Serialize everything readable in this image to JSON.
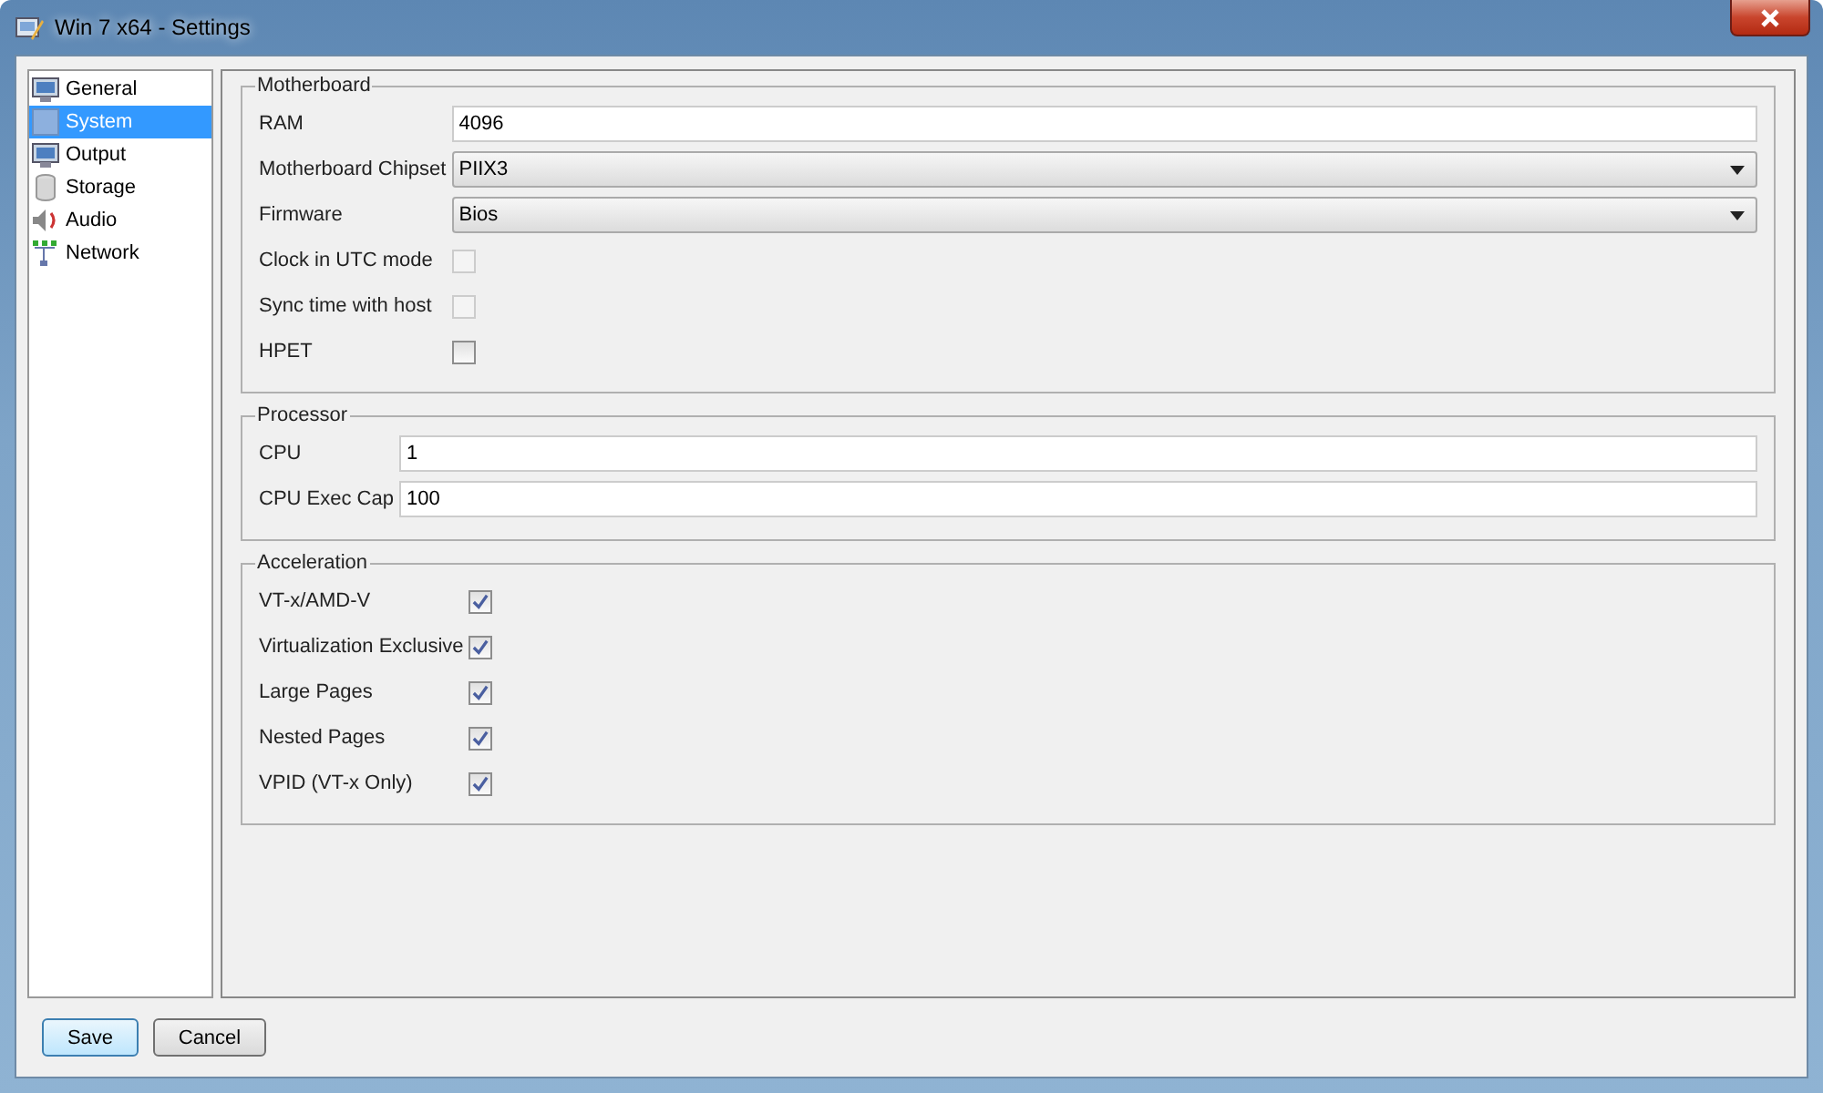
{
  "window": {
    "title": "Win 7 x64 - Settings"
  },
  "sidebar": {
    "items": [
      {
        "label": "General",
        "selected": false
      },
      {
        "label": "System",
        "selected": true
      },
      {
        "label": "Output",
        "selected": false
      },
      {
        "label": "Storage",
        "selected": false
      },
      {
        "label": "Audio",
        "selected": false
      },
      {
        "label": "Network",
        "selected": false
      }
    ]
  },
  "groups": [
    {
      "title": "Motherboard",
      "rows": [
        {
          "kind": "text",
          "label": "RAM",
          "value": "4096"
        },
        {
          "kind": "select",
          "label": "Motherboard Chipset",
          "value": "PIIX3"
        },
        {
          "kind": "select",
          "label": "Firmware",
          "value": "Bios"
        },
        {
          "kind": "checkbox",
          "label": "Clock in UTC mode",
          "checked": false,
          "disabled": true
        },
        {
          "kind": "checkbox",
          "label": "Sync time with host",
          "checked": false,
          "disabled": true
        },
        {
          "kind": "checkbox",
          "label": "HPET",
          "checked": false,
          "disabled": false
        }
      ]
    },
    {
      "title": "Processor",
      "rows": [
        {
          "kind": "text",
          "label": "CPU",
          "value": "1"
        },
        {
          "kind": "text",
          "label": "CPU Exec Cap",
          "value": "100"
        }
      ]
    },
    {
      "title": "Acceleration",
      "rows": [
        {
          "kind": "checkbox",
          "label": "VT-x/AMD-V",
          "checked": true,
          "disabled": false
        },
        {
          "kind": "checkbox",
          "label": "Virtualization Exclusive",
          "checked": true,
          "disabled": false
        },
        {
          "kind": "checkbox",
          "label": "Large Pages",
          "checked": true,
          "disabled": false
        },
        {
          "kind": "checkbox",
          "label": "Nested Pages",
          "checked": true,
          "disabled": false
        },
        {
          "kind": "checkbox",
          "label": "VPID (VT-x Only)",
          "checked": true,
          "disabled": false
        }
      ]
    }
  ],
  "buttons": [
    {
      "label": "Save",
      "default": true
    },
    {
      "label": "Cancel",
      "default": false
    }
  ]
}
